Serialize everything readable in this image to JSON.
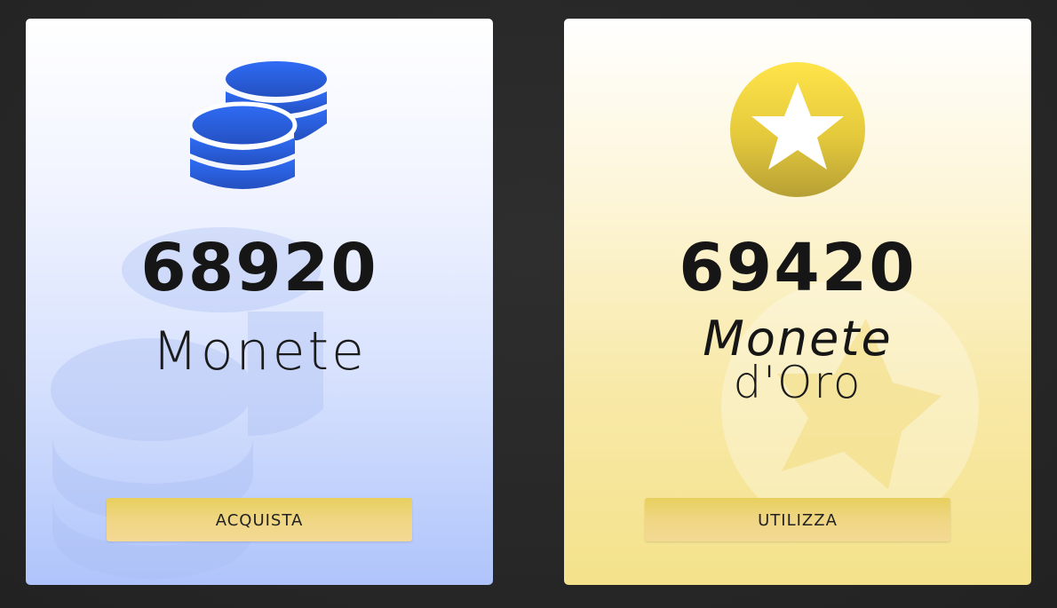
{
  "cards": [
    {
      "id": "coins",
      "amount": "68920",
      "label": "Monete",
      "button_label": "ACQUISTA",
      "icon": "coins-stack-icon",
      "accent": "#2f6cf5"
    },
    {
      "id": "gold",
      "amount": "69420",
      "label_main": "Monete",
      "label_sub": "d'Oro",
      "button_label": "UTILIZZA",
      "icon": "gold-star-coin-icon",
      "accent": "#e8cc3a"
    }
  ],
  "colors": {
    "page_background": "#2a2a2a",
    "button_gold": "#ecd275",
    "text_dark": "#161616"
  }
}
